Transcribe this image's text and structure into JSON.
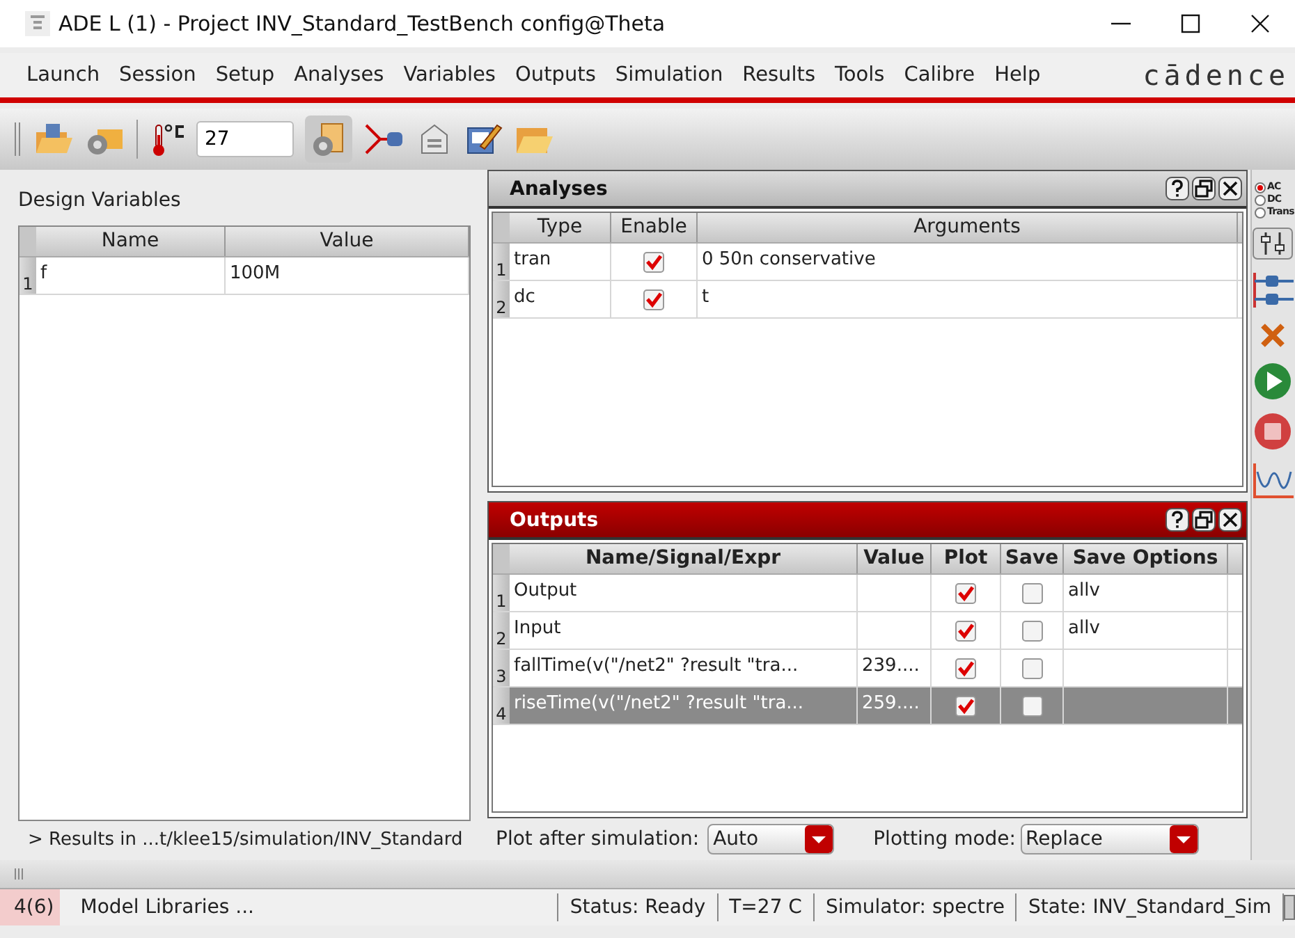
{
  "window": {
    "title": "ADE L (1) - Project INV_Standard_TestBench config@Theta"
  },
  "menu": [
    "Launch",
    "Session",
    "Setup",
    "Analyses",
    "Variables",
    "Outputs",
    "Simulation",
    "Results",
    "Tools",
    "Calibre",
    "Help"
  ],
  "brand": "cādence",
  "toolbar": {
    "temperature": "27"
  },
  "design_variables": {
    "title": "Design Variables",
    "columns": [
      "Name",
      "Value"
    ],
    "rows": [
      {
        "index": "1",
        "name": "f",
        "value": "100M"
      }
    ]
  },
  "results_path": "> Results in ...t/klee15/simulation/INV_Standard",
  "analyses": {
    "title": "Analyses",
    "active": false,
    "columns": [
      "Type",
      "Enable",
      "Arguments"
    ],
    "rows": [
      {
        "index": "1",
        "type": "tran",
        "enabled": true,
        "arguments": "0 50n conservative"
      },
      {
        "index": "2",
        "type": "dc",
        "enabled": true,
        "arguments": "t"
      }
    ]
  },
  "outputs": {
    "title": "Outputs",
    "active": true,
    "columns": [
      "Name/Signal/Expr",
      "Value",
      "Plot",
      "Save",
      "Save Options"
    ],
    "rows": [
      {
        "index": "1",
        "name": "Output",
        "plot": true,
        "save": false,
        "save_options": "allv",
        "selected": false
      },
      {
        "index": "2",
        "name": "Input",
        "plot": true,
        "save": false,
        "save_options": "allv",
        "selected": false
      },
      {
        "index": "3",
        "name": "fallTime(v(\"/net2\" ?result \"tra...",
        "value": "239....",
        "plot": true,
        "save": false,
        "selected": false
      },
      {
        "index": "4",
        "name": "riseTime(v(\"/net2\" ?result \"tra...",
        "value": "259....",
        "plot": true,
        "save": false,
        "selected": true
      }
    ]
  },
  "plot_controls": {
    "plot_after_label": "Plot after simulation:",
    "plot_after": "Auto",
    "mode_label": "Plotting mode:",
    "mode": "Replace"
  },
  "side_toolbar": {
    "analysis_types": [
      {
        "label": "AC",
        "selected": true
      },
      {
        "label": "DC",
        "selected": false
      },
      {
        "label": "Trans",
        "selected": false
      }
    ]
  },
  "status_bar": [
    "4(6)",
    "Model Libraries ...",
    "Status: Ready",
    "T=27 C",
    "Simulator: spectre",
    "State: INV_Standard_Sim"
  ]
}
